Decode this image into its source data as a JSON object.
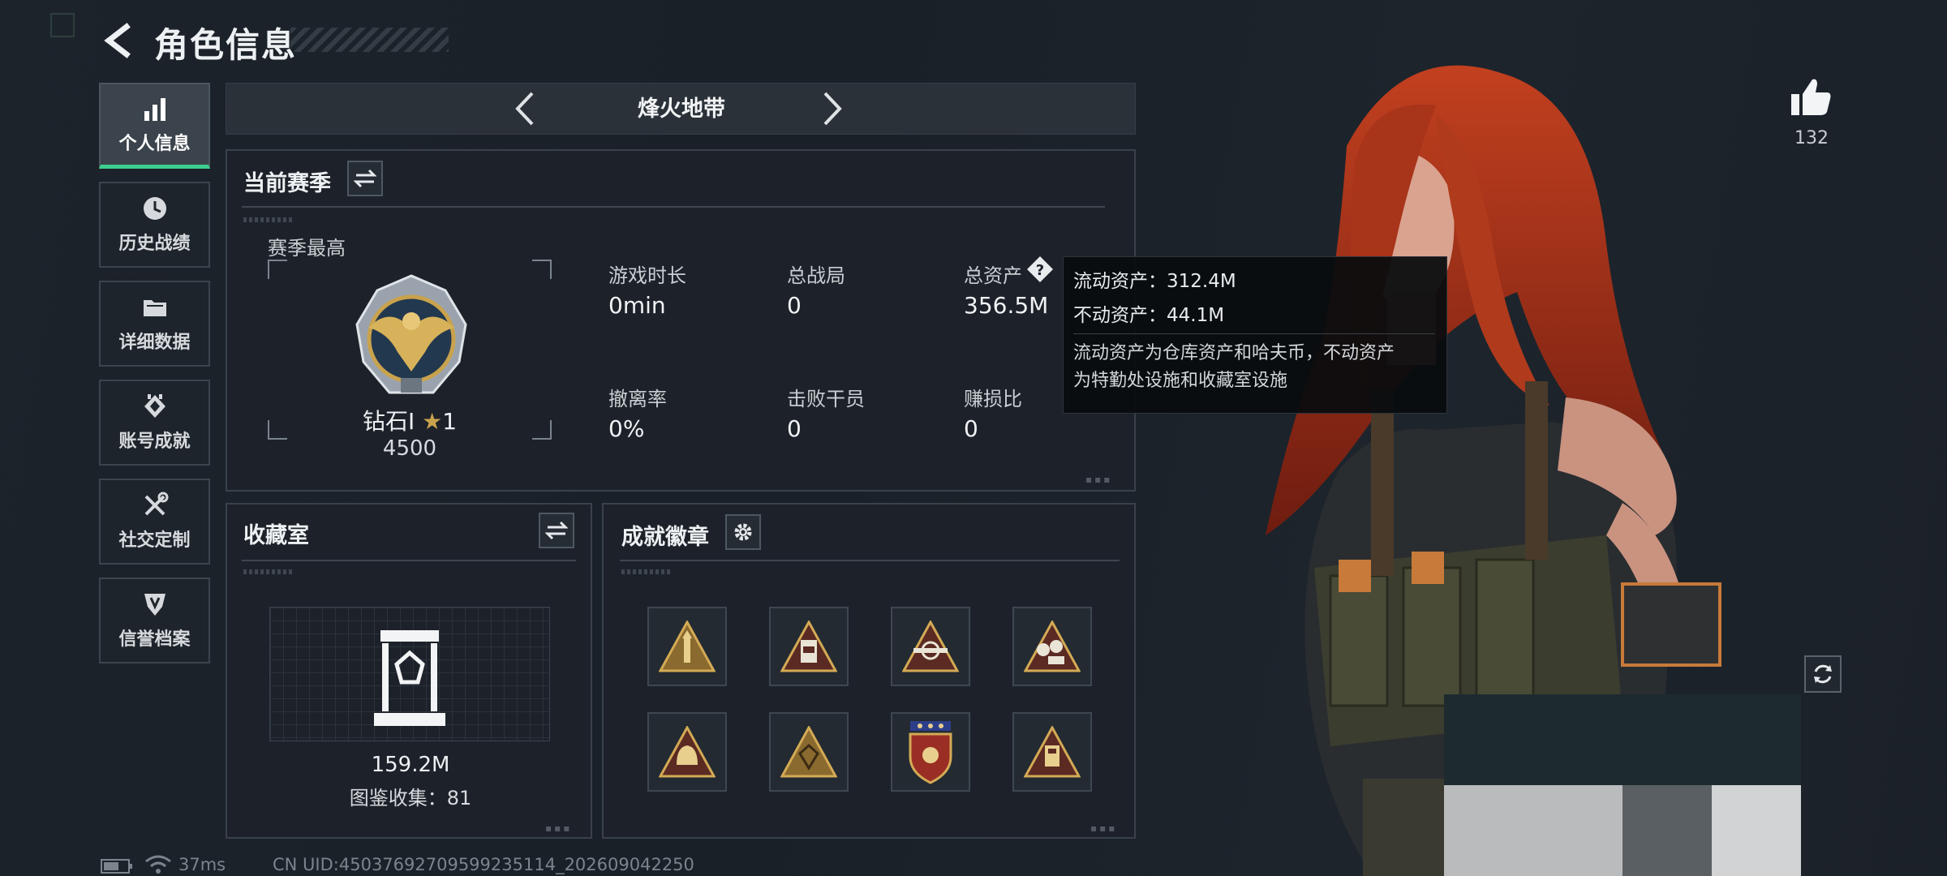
{
  "header": {
    "title": "角色信息"
  },
  "nav": [
    {
      "label": "个人信息",
      "icon": "bar-chart-icon",
      "active": true
    },
    {
      "label": "历史战绩",
      "icon": "clock-icon",
      "active": false
    },
    {
      "label": "详细数据",
      "icon": "folder-icon",
      "active": false
    },
    {
      "label": "账号成就",
      "icon": "medal-icon",
      "active": false
    },
    {
      "label": "社交定制",
      "icon": "tools-icon",
      "active": false
    },
    {
      "label": "信誉档案",
      "icon": "shield-icon",
      "active": false
    }
  ],
  "map": {
    "name": "烽火地带"
  },
  "season": {
    "title": "当前赛季",
    "best_label": "赛季最高",
    "rank": "钻石I",
    "stars": "1",
    "score": "4500",
    "stats": [
      {
        "label": "游戏时长",
        "value": "0min"
      },
      {
        "label": "总战局",
        "value": "0"
      },
      {
        "label": "总资产",
        "value": "356.5M"
      },
      {
        "label": "撤离率",
        "value": "0%"
      },
      {
        "label": "击败干员",
        "value": "0"
      },
      {
        "label": "赚损比",
        "value": "0"
      }
    ]
  },
  "tooltip": {
    "liquid": "流动资产：312.4M",
    "fixed": "不动资产：44.1M",
    "desc_1": "流动资产为仓库资产和哈夫币，不动资产",
    "desc_2": "为特勤处设施和收藏室设施"
  },
  "collection": {
    "title": "收藏室",
    "value": "159.2M",
    "catalog": "图鉴收集：81"
  },
  "badges": {
    "title": "成就徽章",
    "items": [
      "rocket-badge-icon",
      "ammo-badge-icon",
      "weapon-badge-icon",
      "cash-badge-icon",
      "helmet-badge-icon",
      "gem-badge-icon",
      "shield-badge-icon",
      "card-badge-icon"
    ]
  },
  "likes": {
    "count": "132"
  },
  "footer": {
    "ping": "37ms",
    "uid": "CN UID:4503769270959923511​4_202609042250"
  },
  "colors": {
    "accent": "#3ccf8e",
    "gold": "#c9a24d",
    "hair": "#b8321c"
  }
}
